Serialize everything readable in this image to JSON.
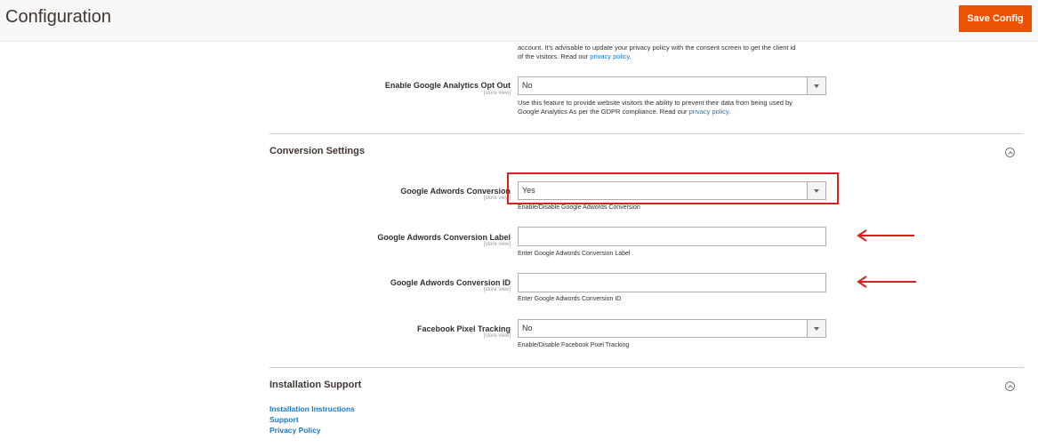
{
  "header": {
    "title": "Configuration",
    "save_label": "Save Config",
    "accent": "#eb5202"
  },
  "top_note": {
    "line1": "account. It's advisable to update your privacy policy with the consent screen to get the client id",
    "line2_prefix": "of the visitors. Read our ",
    "link": "privacy policy",
    "line2_suffix": "."
  },
  "ga_optout": {
    "label": "Enable Google Analytics Opt Out",
    "scope": "[store view]",
    "value": "No",
    "note_line1": "Use this feature to provide website visitors the ability to prevent their data from being used by",
    "note_line2_prefix": "Google Analytics As per the GDPR compliance. Read our ",
    "note_link": "privacy policy",
    "note_line2_suffix": "."
  },
  "conversion": {
    "title": "Conversion Settings",
    "adwords_conversion": {
      "label": "Google Adwords Conversion",
      "scope": "[store view]",
      "value": "Yes",
      "hint": "Enable/Disable Google Adwords Conversion"
    },
    "adwords_label": {
      "label": "Google Adwords Conversion Label",
      "scope": "[store view]",
      "value": "",
      "hint": "Enter Google Adwords Conversion Label"
    },
    "adwords_id": {
      "label": "Google Adwords Conversion ID",
      "scope": "[store view]",
      "value": "",
      "hint": "Enter Google Adwords Conversion ID"
    },
    "fb_pixel": {
      "label": "Facebook Pixel Tracking",
      "scope": "[store view]",
      "value": "No",
      "hint": "Enable/Disable Facebook Pixel Tracking"
    }
  },
  "installation": {
    "title": "Installation Support",
    "links": [
      "Installation Instructions",
      "Support",
      "Privacy Policy"
    ]
  },
  "colors": {
    "link": "#1979c3",
    "annotation_red": "#d9211c"
  }
}
